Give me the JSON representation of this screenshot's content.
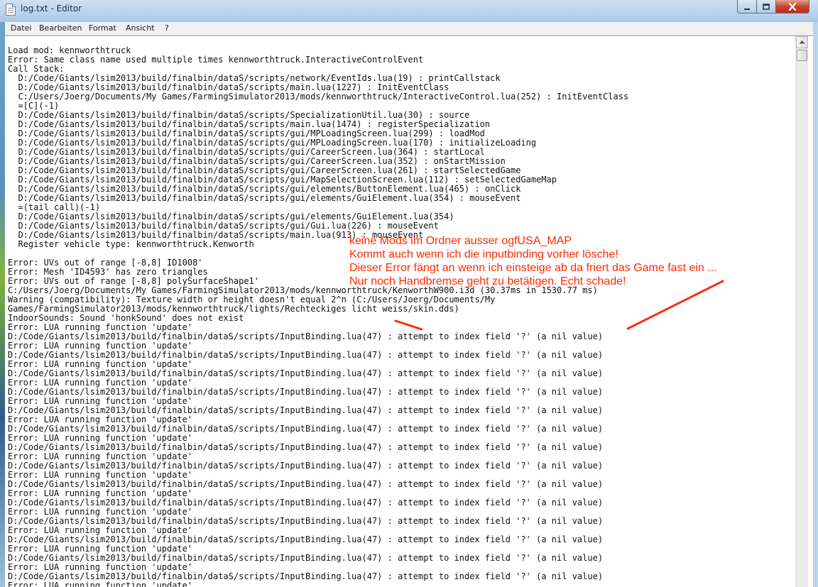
{
  "window": {
    "title": "log.txt - Editor",
    "buttons": {
      "minimize": "minimize",
      "maximize": "maximize",
      "close": "close"
    }
  },
  "menu": [
    "Datei",
    "Bearbeiten",
    "Format",
    "Ansicht",
    "?"
  ],
  "colors": {
    "annotation": "#ff2a00",
    "title_bar": "#bcd3ec",
    "close_button": "#c8432e"
  },
  "log_lines": [
    "Load mod: kennworthtruck",
    "Error: Same class name used multiple times kennworthtruck.InteractiveControlEvent",
    "Call Stack:",
    "  D:/Code/Giants/lsim2013/build/finalbin/dataS/scripts/network/EventIds.lua(19) : printCallstack",
    "  D:/Code/Giants/lsim2013/build/finalbin/dataS/scripts/main.lua(1227) : InitEventClass",
    "  C:/Users/Joerg/Documents/My Games/FarmingSimulator2013/mods/kennworthtruck/InteractiveControl.lua(252) : InitEventClass",
    "  =[C](-1)",
    "  D:/Code/Giants/lsim2013/build/finalbin/dataS/scripts/SpecializationUtil.lua(30) : source",
    "  D:/Code/Giants/lsim2013/build/finalbin/dataS/scripts/main.lua(1474) : registerSpecialization",
    "  D:/Code/Giants/lsim2013/build/finalbin/dataS/scripts/gui/MPLoadingScreen.lua(299) : loadMod",
    "  D:/Code/Giants/lsim2013/build/finalbin/dataS/scripts/gui/MPLoadingScreen.lua(170) : initializeLoading",
    "  D:/Code/Giants/lsim2013/build/finalbin/dataS/scripts/gui/CareerScreen.lua(364) : startLocal",
    "  D:/Code/Giants/lsim2013/build/finalbin/dataS/scripts/gui/CareerScreen.lua(352) : onStartMission",
    "  D:/Code/Giants/lsim2013/build/finalbin/dataS/scripts/gui/CareerScreen.lua(261) : startSelectedGame",
    "  D:/Code/Giants/lsim2013/build/finalbin/dataS/scripts/gui/MapSelectionScreen.lua(112) : setSelectedGameMap",
    "  D:/Code/Giants/lsim2013/build/finalbin/dataS/scripts/gui/elements/ButtonElement.lua(465) : onClick",
    "  D:/Code/Giants/lsim2013/build/finalbin/dataS/scripts/gui/elements/GuiElement.lua(354) : mouseEvent",
    "  =(tail call)(-1)",
    "  D:/Code/Giants/lsim2013/build/finalbin/dataS/scripts/gui/elements/GuiElement.lua(354)",
    "  D:/Code/Giants/lsim2013/build/finalbin/dataS/scripts/gui/Gui.lua(226) : mouseEvent",
    "  D:/Code/Giants/lsim2013/build/finalbin/dataS/scripts/main.lua(913) : mouseEvent",
    "  Register vehicle type: kennworthtruck.Kenworth",
    "",
    "Error: UVs out of range [-8,8] ID1008'",
    "Error: Mesh 'ID4593' has zero triangles",
    "Error: UVs out of range [-8,8] polySurfaceShape1'",
    "C:/Users/Joerg/Documents/My Games/FarmingSimulator2013/mods/kennworthtruck/KenworthW900.i3d (30.37ms in 1530.77 ms)",
    "Warning (compatibility): Texture width or height doesn't equal 2^n (C:/Users/Joerg/Documents/My",
    "Games/FarmingSimulator2013/mods/kennworthtruck/lights/Rechteckiges licht weiss/skin.dds)",
    "IndoorSounds: Sound 'honkSound' does not exist",
    "Error: LUA running function 'update'",
    "D:/Code/Giants/lsim2013/build/finalbin/dataS/scripts/InputBinding.lua(47) : attempt to index field '?' (a nil value)",
    "Error: LUA running function 'update'",
    "D:/Code/Giants/lsim2013/build/finalbin/dataS/scripts/InputBinding.lua(47) : attempt to index field '?' (a nil value)",
    "Error: LUA running function 'update'",
    "D:/Code/Giants/lsim2013/build/finalbin/dataS/scripts/InputBinding.lua(47) : attempt to index field '?' (a nil value)",
    "Error: LUA running function 'update'",
    "D:/Code/Giants/lsim2013/build/finalbin/dataS/scripts/InputBinding.lua(47) : attempt to index field '?' (a nil value)",
    "Error: LUA running function 'update'",
    "D:/Code/Giants/lsim2013/build/finalbin/dataS/scripts/InputBinding.lua(47) : attempt to index field '?' (a nil value)",
    "Error: LUA running function 'update'",
    "D:/Code/Giants/lsim2013/build/finalbin/dataS/scripts/InputBinding.lua(47) : attempt to index field '?' (a nil value)",
    "Error: LUA running function 'update'",
    "D:/Code/Giants/lsim2013/build/finalbin/dataS/scripts/InputBinding.lua(47) : attempt to index field '?' (a nil value)",
    "Error: LUA running function 'update'",
    "D:/Code/Giants/lsim2013/build/finalbin/dataS/scripts/InputBinding.lua(47) : attempt to index field '?' (a nil value)",
    "Error: LUA running function 'update'",
    "D:/Code/Giants/lsim2013/build/finalbin/dataS/scripts/InputBinding.lua(47) : attempt to index field '?' (a nil value)",
    "Error: LUA running function 'update'",
    "D:/Code/Giants/lsim2013/build/finalbin/dataS/scripts/InputBinding.lua(47) : attempt to index field '?' (a nil value)",
    "Error: LUA running function 'update'",
    "D:/Code/Giants/lsim2013/build/finalbin/dataS/scripts/InputBinding.lua(47) : attempt to index field '?' (a nil value)",
    "Error: LUA running function 'update'",
    "D:/Code/Giants/lsim2013/build/finalbin/dataS/scripts/InputBinding.lua(47) : attempt to index field '?' (a nil value)",
    "Error: LUA running function 'update'",
    "D:/Code/Giants/lsim2013/build/finalbin/dataS/scripts/InputBinding.lua(47) : attempt to index field '?' (a nil value)",
    "Error: LUA running function 'update'",
    "D:/Code/Giants/lsim2013/build/finalbin/dataS/scripts/InputBinding.lua(47) : attempt to index field '?' (a nil value)",
    "Error: LUA running function 'update'"
  ],
  "annotation": {
    "lines": [
      "keine Mods im Ordner ausser ogfUSA_MAP",
      "Kommt auch wenn ich die inputbinding vorher lösche!",
      "Dieser Error fängt an wenn ich einsteige ab da friert das Game fast ein ...",
      "Nur noch Handbremse geht zu betätigen. Echt schade!"
    ]
  }
}
